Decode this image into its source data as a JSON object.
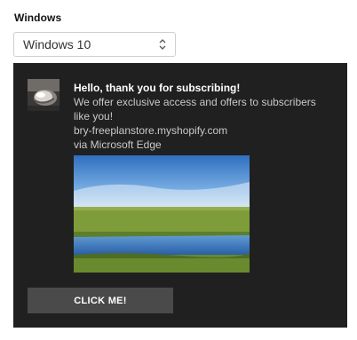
{
  "section": {
    "label": "Windows"
  },
  "os_select": {
    "selected": "Windows 10"
  },
  "notification": {
    "title": "Hello, thank you for subscribing!",
    "body": "We offer exclusive access and offers to subscribers like you!",
    "domain": "bry-freeplanstore.myshopify.com",
    "via": "via Microsoft Edge",
    "button_label": "CLICK ME!",
    "background_color": "#202020",
    "button_color": "#4a4a4a",
    "icon": "shell-thumbnail-icon",
    "image": "landscape-lake-image"
  },
  "colors": {
    "title_text": "#ffffff",
    "body_text": "#c9c9c9"
  }
}
